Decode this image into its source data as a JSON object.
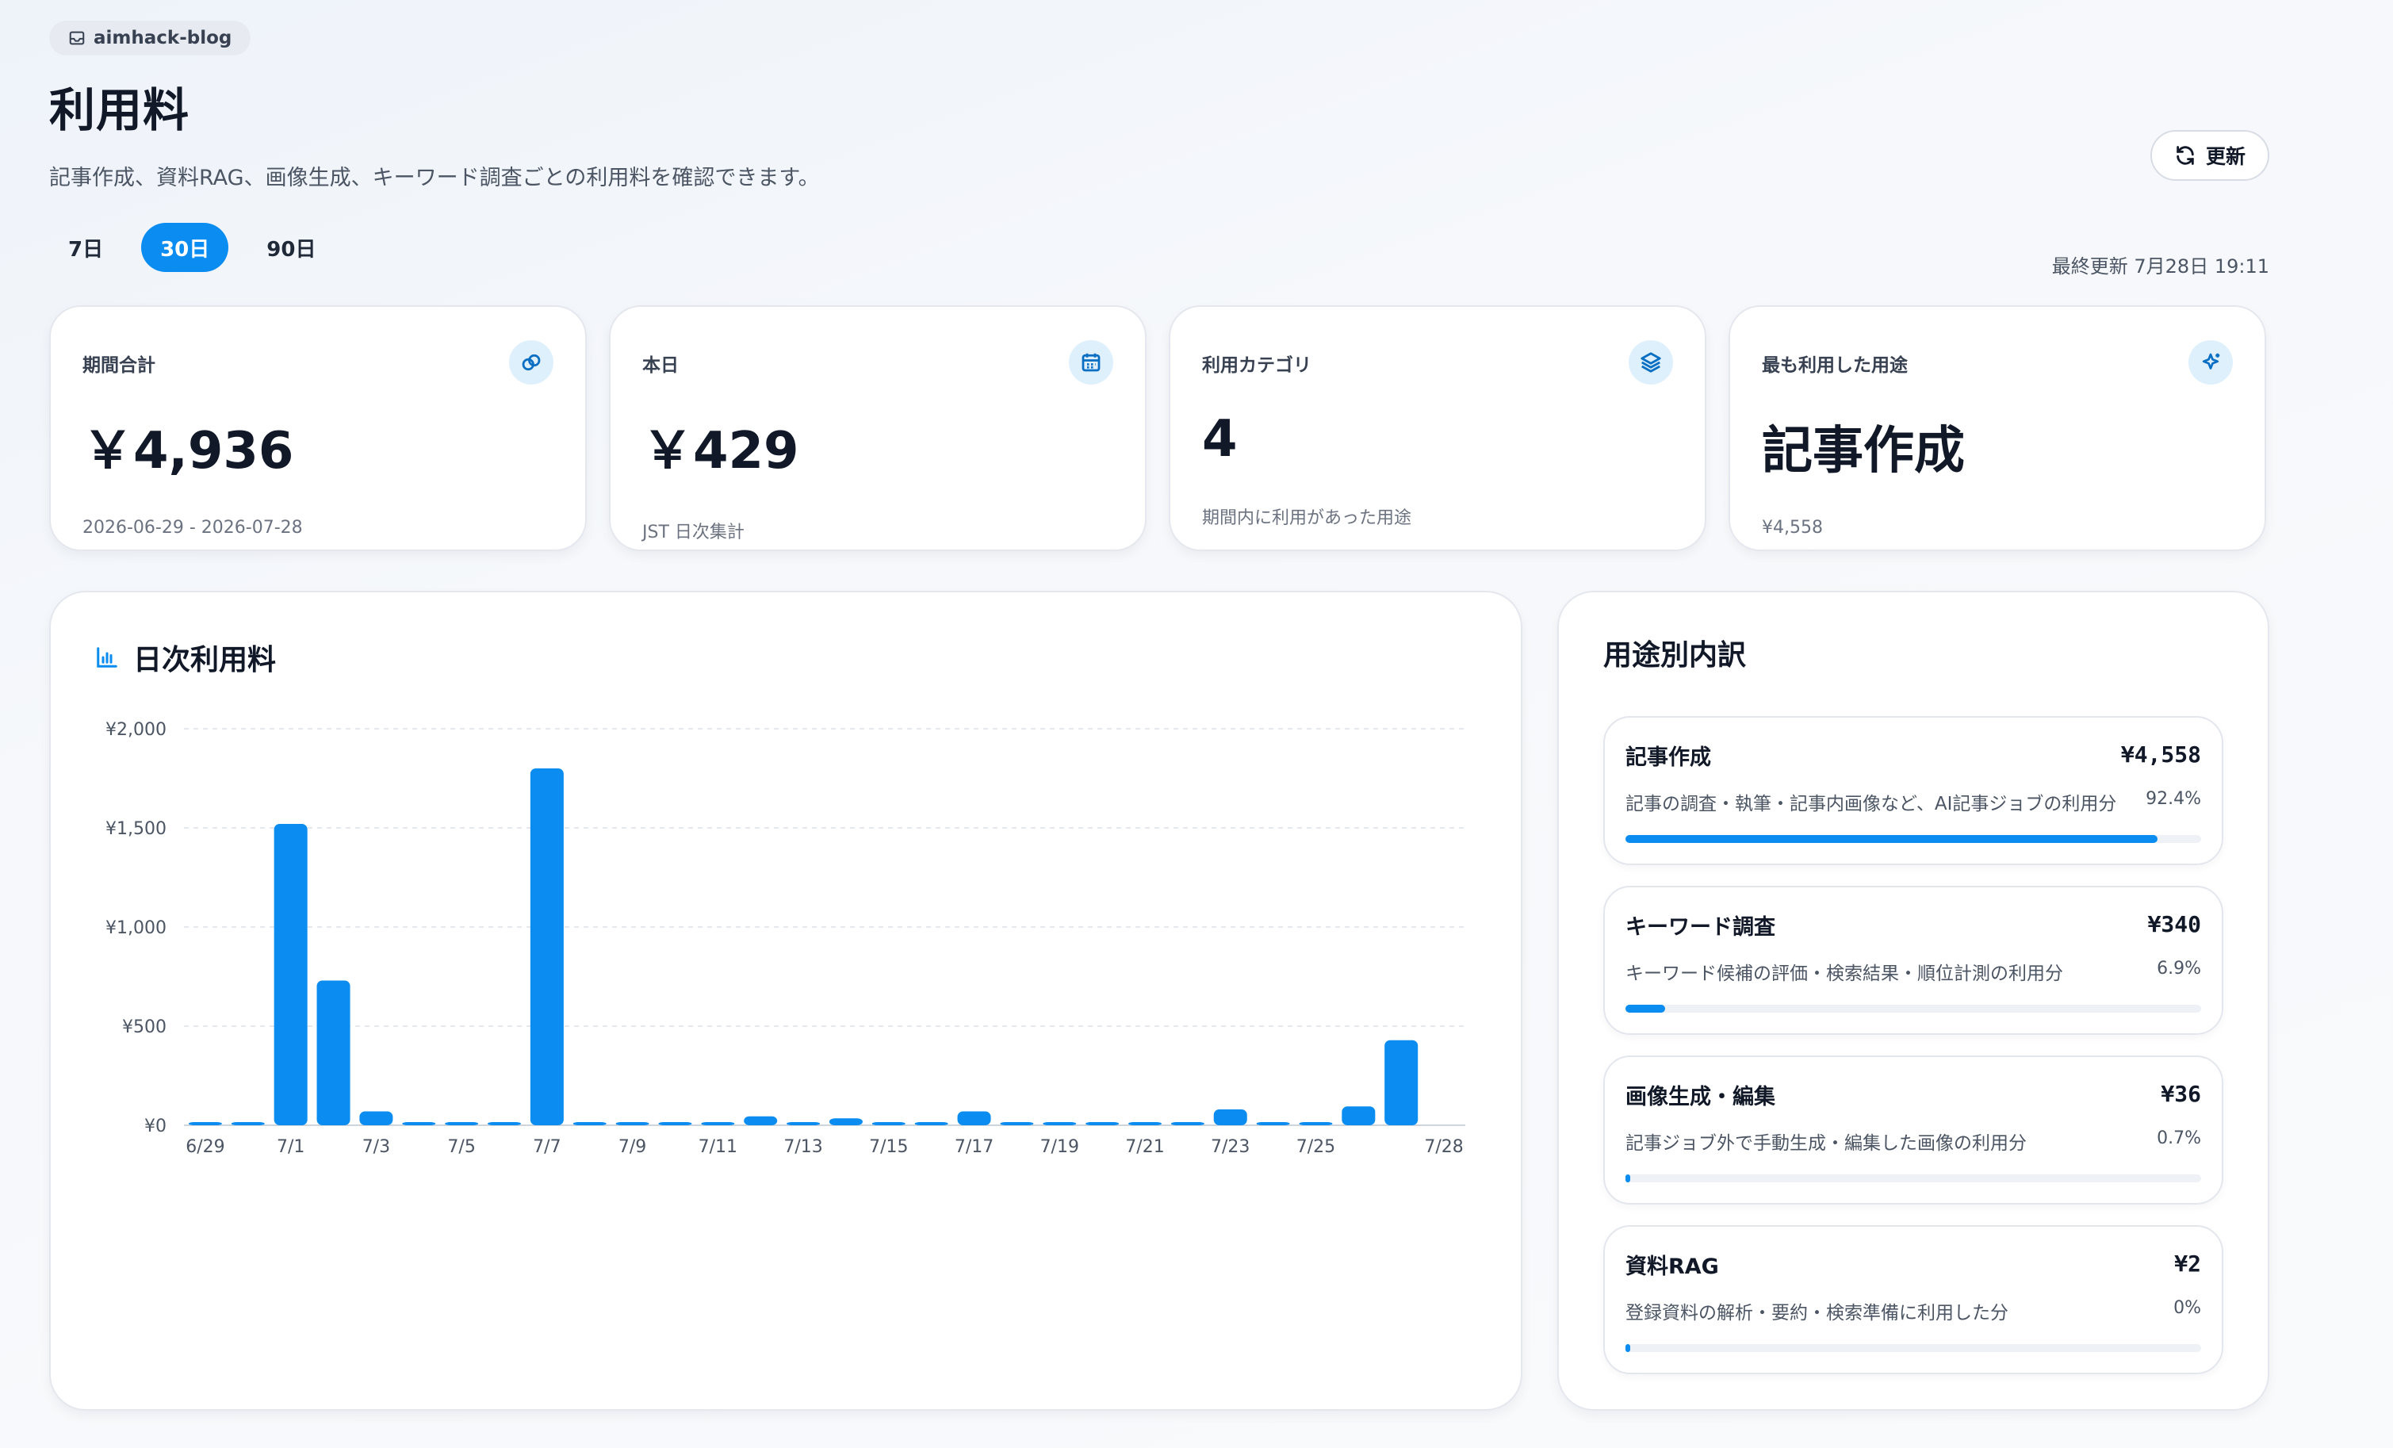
{
  "header": {
    "workspace": "aimhack-blog",
    "title": "利用料",
    "subtitle": "記事作成、資料RAG、画像生成、キーワード調査ごとの利用料を確認できます。",
    "refresh_label": "更新",
    "last_updated": "最終更新 7月28日 19:11"
  },
  "range_tabs": [
    {
      "label": "7日",
      "active": false
    },
    {
      "label": "30日",
      "active": true
    },
    {
      "label": "90日",
      "active": false
    }
  ],
  "stats": [
    {
      "label": "期間合計",
      "value": "￥4,936",
      "note": "2026-06-29 - 2026-07-28",
      "icon": "coins-icon"
    },
    {
      "label": "本日",
      "value": "￥429",
      "note": "JST 日次集計",
      "icon": "calendar-icon"
    },
    {
      "label": "利用カテゴリ",
      "value": "4",
      "note": "期間内に利用があった用途",
      "icon": "layers-icon"
    },
    {
      "label": "最も利用した用途",
      "value": "記事作成",
      "note": "¥4,558",
      "icon": "sparkles-icon"
    }
  ],
  "chart_title": "日次利用料",
  "chart_data": {
    "type": "bar",
    "categories": [
      "6/29",
      "6/30",
      "7/1",
      "7/2",
      "7/3",
      "7/4",
      "7/5",
      "7/6",
      "7/7",
      "7/8",
      "7/9",
      "7/10",
      "7/11",
      "7/12",
      "7/13",
      "7/14",
      "7/15",
      "7/16",
      "7/17",
      "7/18",
      "7/19",
      "7/20",
      "7/21",
      "7/22",
      "7/23",
      "7/24",
      "7/25",
      "7/26",
      "7/27",
      "7/28"
    ],
    "tick_labels": [
      "6/29",
      "7/1",
      "7/3",
      "7/5",
      "7/7",
      "7/9",
      "7/11",
      "7/13",
      "7/15",
      "7/17",
      "7/19",
      "7/21",
      "7/23",
      "7/25",
      "7/28"
    ],
    "values": [
      5,
      5,
      1520,
      730,
      70,
      5,
      5,
      5,
      1800,
      5,
      5,
      15,
      5,
      45,
      10,
      35,
      5,
      5,
      70,
      5,
      5,
      5,
      5,
      5,
      80,
      5,
      5,
      95,
      429,
      0
    ],
    "y_ticks": [
      "¥0",
      "¥500",
      "¥1,000",
      "¥1,500",
      "¥2,000"
    ],
    "ylim": [
      0,
      2000
    ],
    "grid": true,
    "color": "#0a8cf0"
  },
  "breakdown": {
    "title": "用途別内訳",
    "items": [
      {
        "name": "記事作成",
        "amount": "¥4,558",
        "desc": "記事の調査・執筆・記事内画像など、AI記事ジョブの利用分",
        "pct": "92.4%",
        "share": 0.924
      },
      {
        "name": "キーワード調査",
        "amount": "¥340",
        "desc": "キーワード候補の評価・検索結果・順位計測の利用分",
        "pct": "6.9%",
        "share": 0.069
      },
      {
        "name": "画像生成・編集",
        "amount": "¥36",
        "desc": "記事ジョブ外で手動生成・編集した画像の利用分",
        "pct": "0.7%",
        "share": 0.007
      },
      {
        "name": "資料RAG",
        "amount": "¥2",
        "desc": "登録資料の解析・要約・検索準備に利用した分",
        "pct": "0%",
        "share": 0.0
      }
    ]
  }
}
